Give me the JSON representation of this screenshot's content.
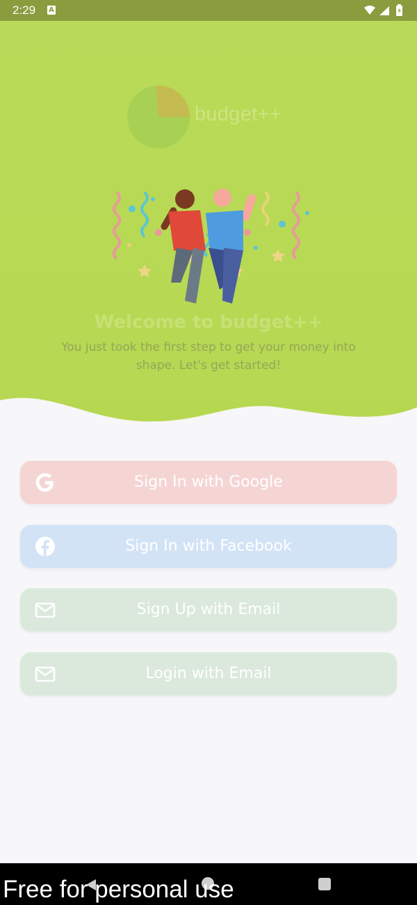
{
  "status_bar": {
    "time": "2:29",
    "notification_icon": "A",
    "icons": [
      "wifi-icon",
      "signal-icon",
      "battery-icon"
    ]
  },
  "logo": {
    "text": "budget++"
  },
  "welcome": {
    "title": "Welcome to budget++",
    "subtitle_line1": "You just took the first step to get your money into",
    "subtitle_line2": "shape. Let's get started!"
  },
  "buttons": [
    {
      "label": "Sign In with Google",
      "icon": "google-icon",
      "color": "#f5d5d4"
    },
    {
      "label": "Sign In with Facebook",
      "icon": "facebook-icon",
      "color": "#d3e3f6"
    },
    {
      "label": "Sign Up with Email",
      "icon": "mail-icon",
      "color": "#dbe9dd"
    },
    {
      "label": "Login with Email",
      "icon": "mail-icon",
      "color": "#dbe9dd"
    }
  ],
  "watermark": "Free for personal use",
  "colors": {
    "hero": "#b8da58",
    "status_bar": "#8a9c3e",
    "background": "#f7f6f8"
  }
}
